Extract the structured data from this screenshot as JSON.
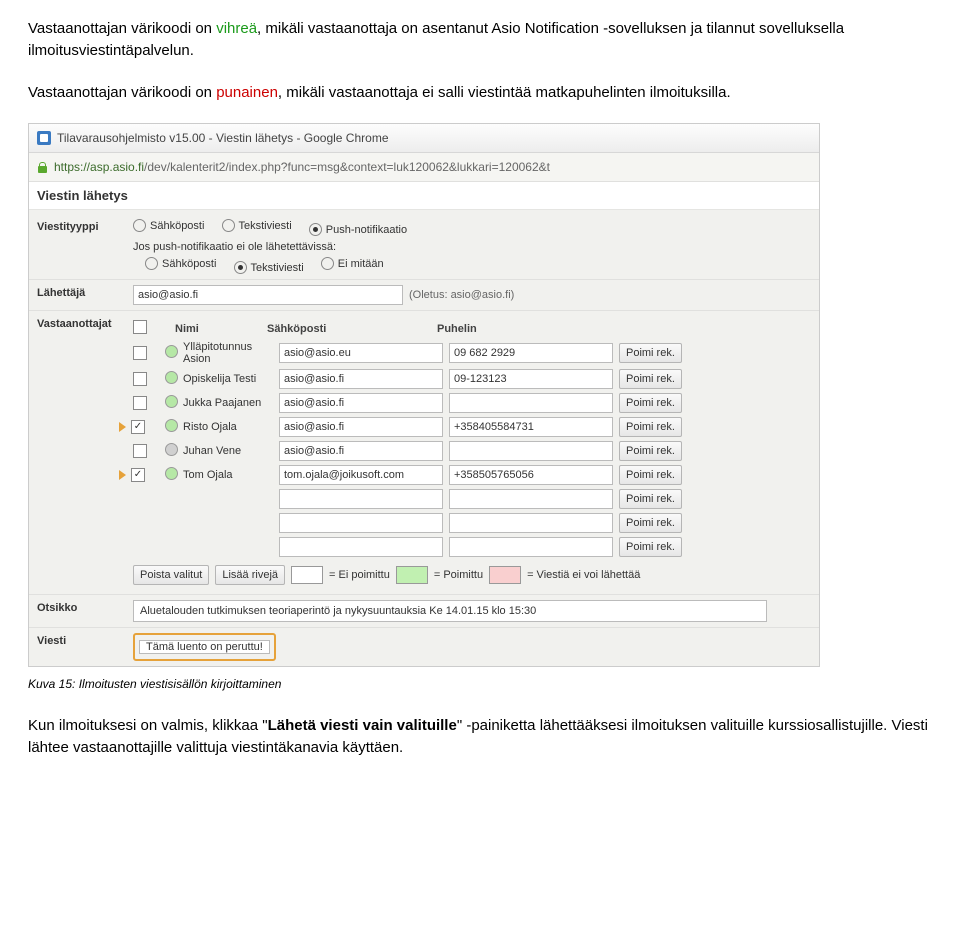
{
  "para1": {
    "p1": "Vastaanottajan värikoodi on ",
    "green": "vihreä",
    "p2": ", mikäli vastaanottaja on asentanut Asio Notification -sovelluksen ja tilannut sovelluksella ilmoitusviestintäpalvelun."
  },
  "para2": {
    "p1": "Vastaanottajan värikoodi on ",
    "red": "punainen",
    "p2": ", mikäli vastaanottaja ei salli viestintää matkapuhelinten ilmoituksilla."
  },
  "window": {
    "title": "Tilavarausohjelmisto v15.00 - Viestin lähetys - Google Chrome",
    "url_host": "https://asp.asio.fi",
    "url_rest": "/dev/kalenterit2/index.php?func=msg&context=luk120062&lukkari=120062&t"
  },
  "form": {
    "section_title": "Viestin lähetys",
    "type_label": "Viestityyppi",
    "type_email": "Sähköposti",
    "type_sms": "Tekstiviesti",
    "type_push": "Push-notifikaatio",
    "fallback_label": "Jos push-notifikaatio ei ole lähetettävissä:",
    "fallback_email": "Sähköposti",
    "fallback_sms": "Tekstiviesti",
    "fallback_none": "Ei mitään",
    "sender_label": "Lähettäjä",
    "sender_value": "asio@asio.fi",
    "sender_default": "(Oletus: asio@asio.fi)",
    "recipients_label": "Vastaanottajat",
    "col_name": "Nimi",
    "col_email": "Sähköposti",
    "col_phone": "Puhelin",
    "pick_label": "Poimi rek.",
    "remove_selected": "Poista valitut",
    "add_rows": "Lisää rivejä",
    "legend_unpicked": "= Ei poimittu",
    "legend_picked": "= Poimittu",
    "legend_nosend": "= Viestiä ei voi lähettää",
    "subject_label": "Otsikko",
    "subject_value": "Aluetalouden tutkimuksen teoriaperintö ja nykysuuntauksia Ke 14.01.15 klo 15:30",
    "message_label": "Viesti",
    "message_value": "Tämä luento on peruttu!"
  },
  "recipients": [
    {
      "checked": false,
      "arrow": false,
      "status": "green",
      "name": "Ylläpitotunnus Asion",
      "email": "asio@asio.eu",
      "phone": "09 682 2929"
    },
    {
      "checked": false,
      "arrow": false,
      "status": "green",
      "name": "Opiskelija Testi",
      "email": "asio@asio.fi",
      "phone": "09-123123"
    },
    {
      "checked": false,
      "arrow": false,
      "status": "green",
      "name": "Jukka Paajanen",
      "email": "asio@asio.fi",
      "phone": ""
    },
    {
      "checked": true,
      "arrow": true,
      "status": "green",
      "name": "Risto Ojala",
      "email": "asio@asio.fi",
      "phone": "+358405584731"
    },
    {
      "checked": false,
      "arrow": false,
      "status": "gray",
      "name": "Juhan Vene",
      "email": "asio@asio.fi",
      "phone": ""
    },
    {
      "checked": true,
      "arrow": true,
      "status": "green",
      "name": "Tom Ojala",
      "email": "tom.ojala@joikusoft.com",
      "phone": "+358505765056"
    },
    {
      "checked": null,
      "arrow": false,
      "status": null,
      "name": "",
      "email": "",
      "phone": ""
    },
    {
      "checked": null,
      "arrow": false,
      "status": null,
      "name": "",
      "email": "",
      "phone": ""
    },
    {
      "checked": null,
      "arrow": false,
      "status": null,
      "name": "",
      "email": "",
      "phone": ""
    }
  ],
  "caption": "Kuva 15: Ilmoitusten viestisisällön kirjoittaminen",
  "para3": {
    "p1": "Kun ilmoituksesi on valmis, klikkaa \"",
    "bold": "Lähetä viesti vain valituille",
    "p2": "\" -painiketta lähettääksesi ilmoituksen valituille kurssiosallistujille. Viesti lähtee vastaanottajille valittuja viestintäkanavia käyttäen."
  }
}
